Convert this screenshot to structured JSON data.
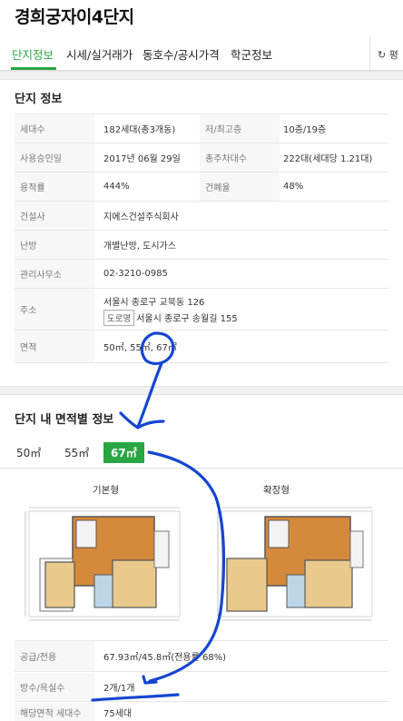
{
  "page": {
    "title": "경희궁자이4단지"
  },
  "tabs": [
    {
      "label": "단지정보"
    },
    {
      "label": "시세/실거래가"
    },
    {
      "label": "동호수/공시가격"
    },
    {
      "label": "학군정보"
    }
  ],
  "refresh_label": "↻ 평",
  "complex_info": {
    "title": "단지 정보",
    "rows": [
      {
        "label": "세대수",
        "value": "182세대(총3개동)",
        "label2": "저/최고층",
        "value2": "10층/19층"
      },
      {
        "label": "사용승인일",
        "value": "2017년 06월 29일",
        "label2": "총주차대수",
        "value2": "222대(세대당 1.21대)"
      },
      {
        "label": "용적률",
        "value": "444%",
        "label2": "건폐율",
        "value2": "48%"
      },
      {
        "label": "건설사",
        "value": "지에스건설주식회사"
      },
      {
        "label": "난방",
        "value": "개별난방, 도시가스"
      },
      {
        "label": "관리사무소",
        "value": "02-3210-0985"
      },
      {
        "label": "주소",
        "address": "서울시 종로구 교북동 126",
        "road_badge": "도로명",
        "road_address": "서울시 종로구 송월길 155"
      },
      {
        "label": "면적",
        "value": "50㎡, 55㎡, 67㎡"
      }
    ]
  },
  "area_info": {
    "title": "단지 내 면적별 정보",
    "tabs": [
      {
        "label": "50㎡"
      },
      {
        "label": "55㎡"
      },
      {
        "label": "67㎡",
        "active": true
      }
    ],
    "plans": [
      {
        "label": "기본형"
      },
      {
        "label": "확장형"
      }
    ],
    "rows": [
      {
        "label": "공급/전용",
        "value": "67.93㎡/45.8㎡(전용률 68%)"
      },
      {
        "label": "방수/욕실수",
        "value": "2개/1개"
      },
      {
        "label": "해당면적 세대수",
        "value": "75세대"
      }
    ]
  },
  "colors": {
    "accent": "#2aa544",
    "annotation": "#1546d1"
  }
}
